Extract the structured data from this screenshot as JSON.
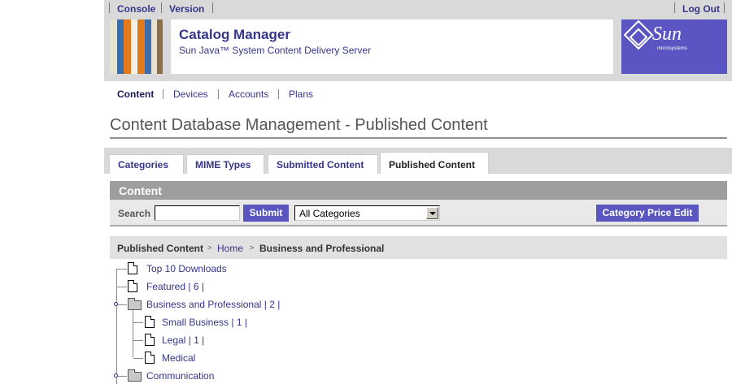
{
  "topnav": {
    "console": "Console",
    "version": "Version",
    "logout": "Log Out"
  },
  "brand": {
    "title": "Catalog Manager",
    "subtitle": "Sun Java™ System Content Delivery Server",
    "logo_text": "Sun",
    "logo_sub": "microsystems"
  },
  "subnav": {
    "items": [
      "Content",
      "Devices",
      "Accounts",
      "Plans"
    ],
    "active": "Content"
  },
  "page_title": "Content Database Management - Published Content",
  "tabs": {
    "items": [
      "Categories",
      "MIME Types",
      "Submitted Content",
      "Published Content"
    ],
    "active": "Published Content"
  },
  "content_header": "Content",
  "search": {
    "label": "Search",
    "value": "",
    "submit": "Submit",
    "category_selected": "All Categories",
    "price_edit": "Category Price Edit"
  },
  "breadcrumb": {
    "root": "Published Content",
    "home": "Home",
    "current": "Business and Professional"
  },
  "tree": [
    {
      "label": "Top 10 Downloads"
    },
    {
      "label": "Featured | 6 |"
    },
    {
      "label": "Business and Professional | 2 |"
    },
    {
      "label": "Small Business | 1 |"
    },
    {
      "label": "Legal | 1 |"
    },
    {
      "label": "Medical"
    },
    {
      "label": "Communication"
    }
  ],
  "colors": {
    "accent": "#5956c0",
    "link": "#35358c",
    "masthead": "#d9d9d9",
    "logo_bg": "#5a55c3"
  }
}
